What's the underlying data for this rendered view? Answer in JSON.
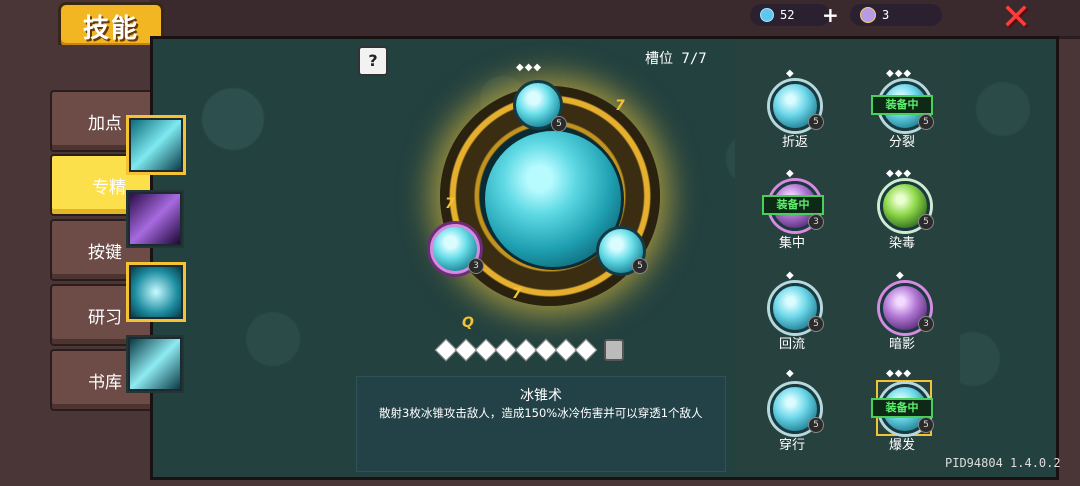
{
  "header": {
    "title": "技能",
    "currency_gems": "52",
    "currency_plus": "+",
    "currency_skull": "3",
    "close_label": "✕"
  },
  "nav": [
    {
      "label": "加点",
      "active": false
    },
    {
      "label": "专精",
      "active": true
    },
    {
      "label": "按键",
      "active": false
    },
    {
      "label": "研习",
      "active": false
    },
    {
      "label": "书库",
      "active": false
    }
  ],
  "help_label": "?",
  "slot_count": "槽位 7/7",
  "skill": {
    "name": "冰锥术",
    "description": "散射3枚冰锥攻击敌人，造成150%冰冷伤害并可以穿透1个敌人"
  },
  "orb_levels": {
    "top": "5",
    "left": "3",
    "right": "5"
  },
  "ring_marks": [
    "7",
    "7",
    "7",
    "Q"
  ],
  "diamonds_count": 8,
  "talents": [
    {
      "label": "折返",
      "level": "5",
      "equipped": false,
      "color": "cyan"
    },
    {
      "label": "分裂",
      "level": "5",
      "equipped": true,
      "color": "cyan"
    },
    {
      "label": "集中",
      "level": "3",
      "equipped": true,
      "color": "purple"
    },
    {
      "label": "染毒",
      "level": "5",
      "equipped": false,
      "color": "green"
    },
    {
      "label": "回流",
      "level": "5",
      "equipped": false,
      "color": "cyan"
    },
    {
      "label": "暗影",
      "level": "3",
      "equipped": false,
      "color": "purple"
    },
    {
      "label": "穿行",
      "level": "5",
      "equipped": false,
      "color": "cyan"
    },
    {
      "label": "爆发",
      "level": "5",
      "equipped": true,
      "color": "cyan"
    }
  ],
  "equipped_label": "装备中",
  "version": "PID94804 1.4.0.2",
  "colors": {
    "accent": "#f5c233",
    "equipped_green": "#5df06c",
    "panel": "#23413f"
  }
}
